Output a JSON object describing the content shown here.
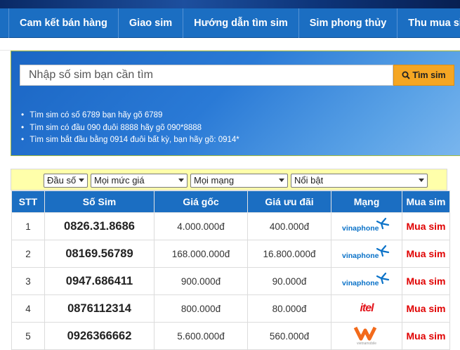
{
  "nav": {
    "items": [
      "Cam kết bán hàng",
      "Giao sim",
      "Hướng dẫn tìm sim",
      "Sim phong thủy",
      "Thu mua sim"
    ]
  },
  "search": {
    "placeholder": "Nhập số sim bạn cần tìm",
    "button_label": "Tìm sim",
    "tips": [
      "Tìm sim có số 6789 bạn hãy gõ 6789",
      "Tìm sim có đầu 090 đuôi 8888 hãy gõ 090*8888",
      "Tìm sim bắt đầu bằng 0914 đuôi bất kỳ, bạn hãy gõ: 0914*"
    ]
  },
  "filters": {
    "prefix": "Đầu số",
    "price": "Mọi mức giá",
    "network": "Mọi mạng",
    "sort": "Nổi bật"
  },
  "table": {
    "headers": [
      "STT",
      "Số Sim",
      "Giá gốc",
      "Giá ưu đãi",
      "Mạng",
      "Mua sim"
    ],
    "rows": [
      {
        "stt": "1",
        "number": "0826.31.8686",
        "original": "4.000.000đ",
        "sale": "400.000đ",
        "network": "vinaphone",
        "buy": "Mua sim"
      },
      {
        "stt": "2",
        "number": "08169.56789",
        "original": "168.000.000đ",
        "sale": "16.800.000đ",
        "network": "vinaphone",
        "buy": "Mua sim"
      },
      {
        "stt": "3",
        "number": "0947.686411",
        "original": "900.000đ",
        "sale": "90.000đ",
        "network": "vinaphone",
        "buy": "Mua sim"
      },
      {
        "stt": "4",
        "number": "0876112314",
        "original": "800.000đ",
        "sale": "80.000đ",
        "network": "itel",
        "buy": "Mua sim"
      },
      {
        "stt": "5",
        "number": "0926366662",
        "original": "5.600.000đ",
        "sale": "560.000đ",
        "network": "vietnamobile",
        "buy": "Mua sim"
      }
    ]
  },
  "colors": {
    "nav_bg": "#1b6ec2",
    "search_button": "#f5a623",
    "filter_bar": "#ffffaa",
    "buy_text": "#e00000",
    "vinaphone": "#0a72c8",
    "itel": "#e3141b",
    "vietnamobile": "#f26a1b"
  }
}
